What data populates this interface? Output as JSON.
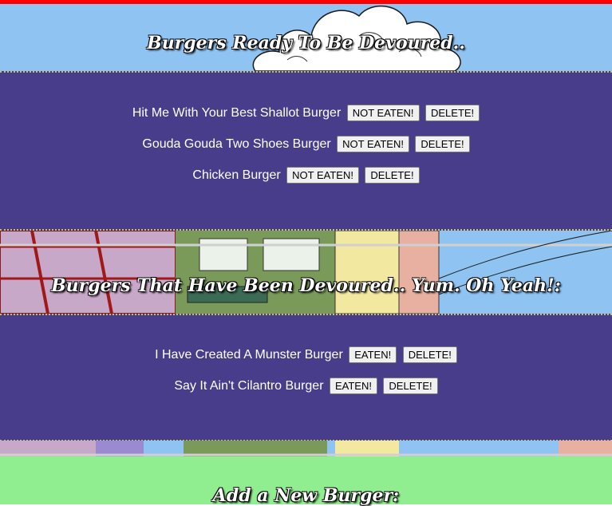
{
  "header": {
    "title": "Burgers Ready To Be Devoured.."
  },
  "ready": {
    "items": [
      {
        "name": "Hit Me With Your Best Shallot Burger",
        "status_label": "NOT EATEN!",
        "delete_label": "DELETE!"
      },
      {
        "name": "Gouda Gouda Two Shoes Burger",
        "status_label": "NOT EATEN!",
        "delete_label": "DELETE!"
      },
      {
        "name": "Chicken Burger",
        "status_label": "NOT EATEN!",
        "delete_label": "DELETE!"
      }
    ]
  },
  "devoured": {
    "title": "Burgers That Have Been Devoured.. Yum. Oh Yeah!:",
    "items": [
      {
        "name": "I Have Created A Munster Burger",
        "status_label": "EATEN!",
        "delete_label": "DELETE!"
      },
      {
        "name": "Say It Ain't Cilantro Burger",
        "status_label": "EATEN!",
        "delete_label": "DELETE!"
      }
    ]
  },
  "add": {
    "title": "Add a New Burger:"
  },
  "colors": {
    "accent_bar": "#ff0000",
    "sky": "#8ec3f2",
    "panel": "#483d8b",
    "add_section": "#90ee90"
  }
}
